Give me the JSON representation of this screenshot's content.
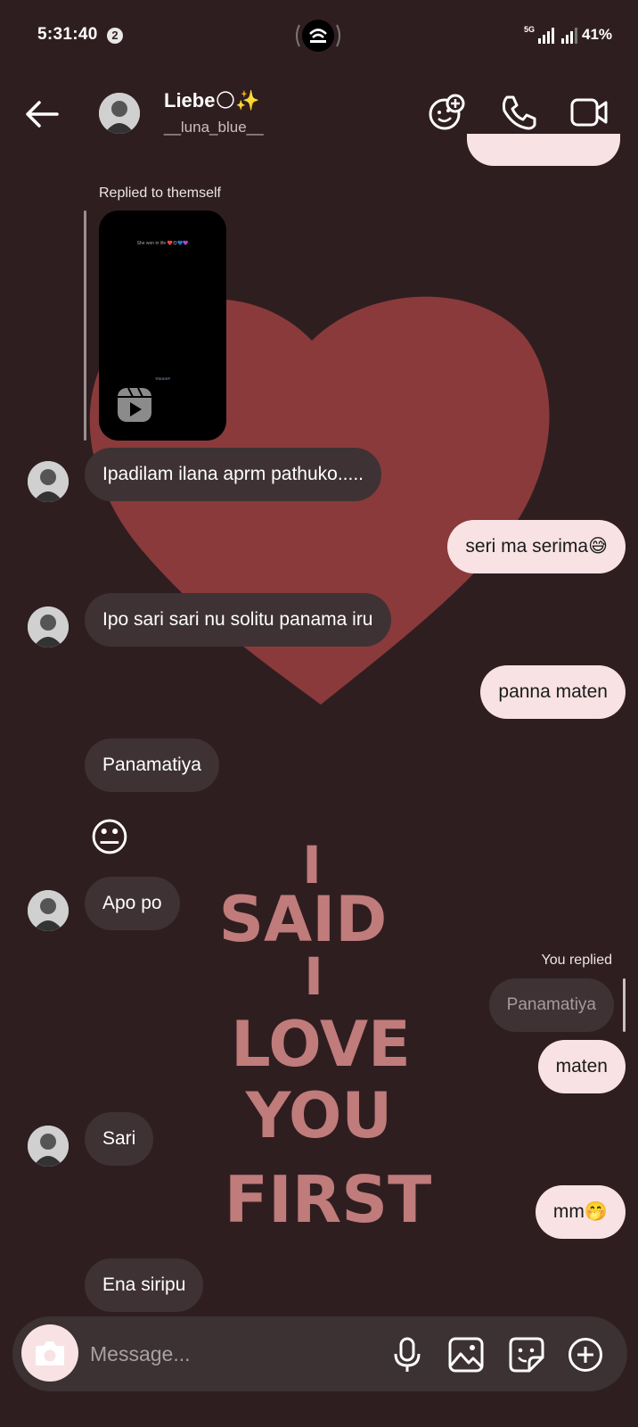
{
  "status_bar": {
    "time": "5:31:40",
    "notification_count": "2",
    "network": "5G",
    "battery": "41%"
  },
  "header": {
    "name": "Liebe🌕✨",
    "handle": "__luna_blue__",
    "icons": [
      "back-arrow-icon",
      "add-emoji-icon",
      "phone-icon",
      "video-call-icon"
    ]
  },
  "thread": {
    "reply_label_1": "Replied to themself",
    "reel_caption": "She won in life ❤️😍💙💜",
    "reel_logo_text": "TRIDEEP",
    "messages": [
      {
        "from": "them",
        "text": "Ipadilam ilana aprm pathuko....."
      },
      {
        "from": "me",
        "text": "seri ma serima😅"
      },
      {
        "from": "them",
        "text": "Ipo sari sari nu solitu panama iru"
      },
      {
        "from": "me",
        "text": "panna maten"
      },
      {
        "from": "them",
        "text": "Panamatiya"
      },
      {
        "from": "them",
        "text": "😐"
      },
      {
        "from": "them",
        "text": "Apo po"
      },
      {
        "from": "me",
        "text": "maten"
      },
      {
        "from": "them",
        "text": "Sari"
      },
      {
        "from": "me",
        "text": "mm🤭"
      },
      {
        "from": "them",
        "text": "Ena siripu"
      }
    ],
    "reply_label_2": "You replied",
    "quoted_text": "Panamatiya"
  },
  "background_art": {
    "line1": "I",
    "line2": "SAID",
    "line3": "I",
    "line4": "LOVE",
    "line5": "YOU",
    "line6": "FIRST"
  },
  "composer": {
    "placeholder": "Message...",
    "icons": [
      "camera-icon",
      "microphone-icon",
      "gallery-icon",
      "sticker-icon",
      "plus-icon"
    ]
  },
  "colors": {
    "background": "#2f1e20",
    "heart": "#8a3a3b",
    "received_bubble": "#3e3234",
    "sent_bubble": "#f8e2e3",
    "art_text": "#c07b7b"
  }
}
